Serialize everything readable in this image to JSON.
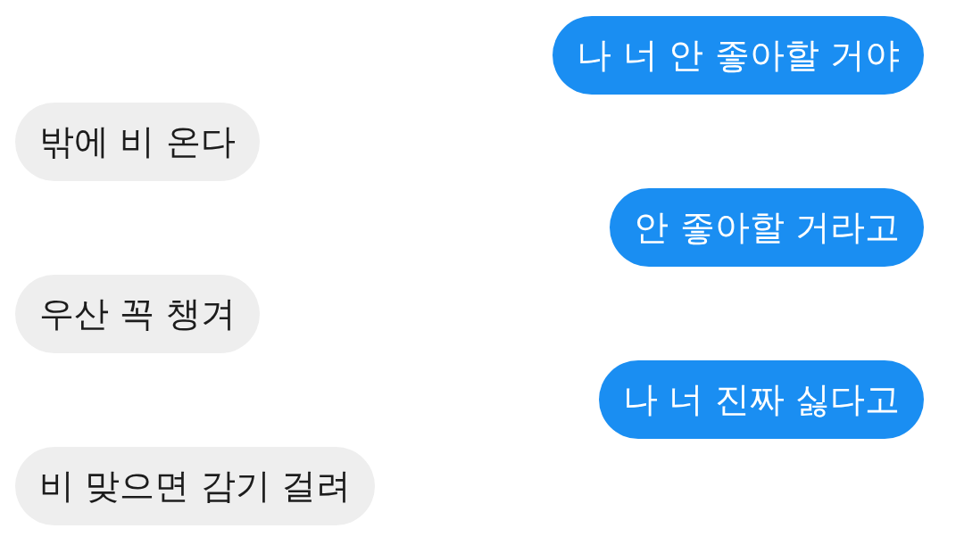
{
  "messages": [
    {
      "kind": "sent",
      "text": "나 너 안 좋아할 거야"
    },
    {
      "kind": "received",
      "text": "밖에 비 온다"
    },
    {
      "kind": "sent",
      "text": "안 좋아할 거라고"
    },
    {
      "kind": "received",
      "text": "우산 꼭 챙겨"
    },
    {
      "kind": "sent",
      "text": "나 너 진짜 싫다고"
    },
    {
      "kind": "received",
      "text": "비 맞으면 감기 걸려"
    }
  ]
}
